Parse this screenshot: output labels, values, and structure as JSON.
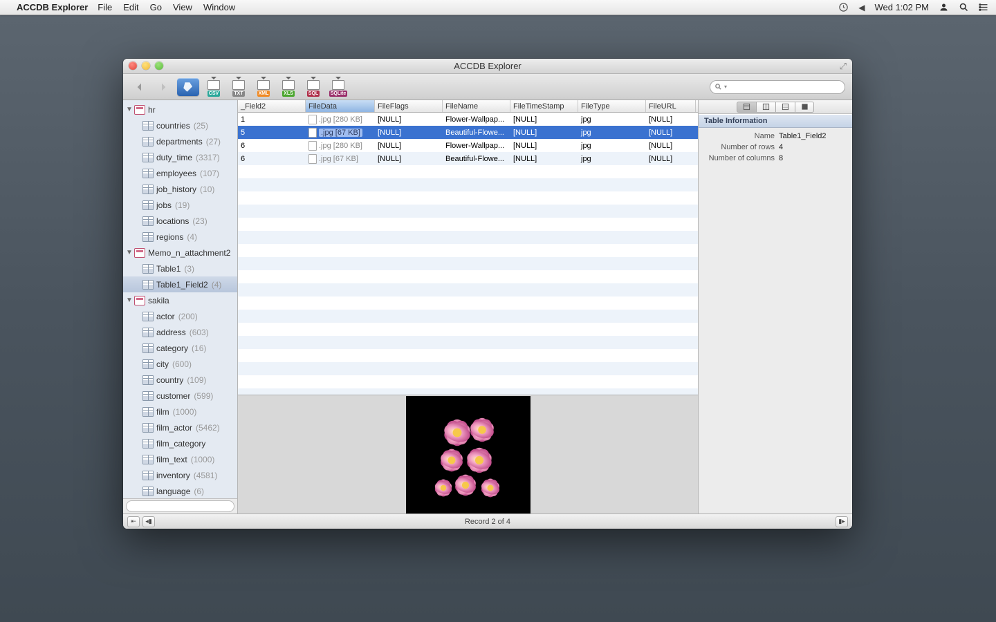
{
  "menubar": {
    "app": "ACCDB Explorer",
    "items": [
      "File",
      "Edit",
      "Go",
      "View",
      "Window"
    ],
    "clock": "Wed 1:02 PM"
  },
  "window": {
    "title": "ACCDB Explorer",
    "search_placeholder": "",
    "exports": [
      {
        "label": "CSV",
        "cls": "tag-csv"
      },
      {
        "label": "TXT",
        "cls": "tag-txt"
      },
      {
        "label": "XML",
        "cls": "tag-xml"
      },
      {
        "label": "XLS",
        "cls": "tag-xls"
      },
      {
        "label": "SQL",
        "cls": "tag-sql"
      },
      {
        "label": "SQLite",
        "cls": "tag-sqlite"
      }
    ]
  },
  "sidebar": {
    "databases": [
      {
        "name": "hr",
        "expanded": true,
        "tables": [
          {
            "name": "countries",
            "count": "(25)"
          },
          {
            "name": "departments",
            "count": "(27)"
          },
          {
            "name": "duty_time",
            "count": "(3317)"
          },
          {
            "name": "employees",
            "count": "(107)"
          },
          {
            "name": "job_history",
            "count": "(10)"
          },
          {
            "name": "jobs",
            "count": "(19)"
          },
          {
            "name": "locations",
            "count": "(23)"
          },
          {
            "name": "regions",
            "count": "(4)"
          }
        ]
      },
      {
        "name": "Memo_n_attachment2",
        "expanded": true,
        "tables": [
          {
            "name": "Table1",
            "count": "(3)"
          },
          {
            "name": "Table1_Field2",
            "count": "(4)",
            "selected": true
          }
        ]
      },
      {
        "name": "sakila",
        "expanded": true,
        "tables": [
          {
            "name": "actor",
            "count": "(200)"
          },
          {
            "name": "address",
            "count": "(603)"
          },
          {
            "name": "category",
            "count": "(16)"
          },
          {
            "name": "city",
            "count": "(600)"
          },
          {
            "name": "country",
            "count": "(109)"
          },
          {
            "name": "customer",
            "count": "(599)"
          },
          {
            "name": "film",
            "count": "(1000)"
          },
          {
            "name": "film_actor",
            "count": "(5462)"
          },
          {
            "name": "film_category",
            "count": ""
          },
          {
            "name": "film_text",
            "count": "(1000)"
          },
          {
            "name": "inventory",
            "count": "(4581)"
          },
          {
            "name": "language",
            "count": "(6)"
          }
        ]
      }
    ]
  },
  "grid": {
    "columns": [
      "_Field2",
      "FileData",
      "FileFlags",
      "FileName",
      "FileTimeStamp",
      "FileType",
      "FileURL"
    ],
    "sort_col": 1,
    "rows": [
      {
        "f2": "1",
        "data": ".jpg [280 KB]",
        "flags": "[NULL]",
        "name": "Flower-Wallpap...",
        "ts": "[NULL]",
        "type": "jpg",
        "url": "[NULL]"
      },
      {
        "f2": "5",
        "data": ".jpg [67 KB]",
        "flags": "[NULL]",
        "name": "Beautiful-Flowe...",
        "ts": "[NULL]",
        "type": "jpg",
        "url": "[NULL]",
        "selected": true
      },
      {
        "f2": "6",
        "data": ".jpg [280 KB]",
        "flags": "[NULL]",
        "name": "Flower-Wallpap...",
        "ts": "[NULL]",
        "type": "jpg",
        "url": "[NULL]"
      },
      {
        "f2": "6",
        "data": ".jpg [67 KB]",
        "flags": "[NULL]",
        "name": "Beautiful-Flowe...",
        "ts": "[NULL]",
        "type": "jpg",
        "url": "[NULL]"
      }
    ]
  },
  "inspector": {
    "heading": "Table Information",
    "rows": [
      {
        "k": "Name",
        "v": "Table1_Field2"
      },
      {
        "k": "Number of rows",
        "v": "4"
      },
      {
        "k": "Number of columns",
        "v": "8"
      }
    ]
  },
  "status": {
    "text": "Record 2 of 4"
  }
}
